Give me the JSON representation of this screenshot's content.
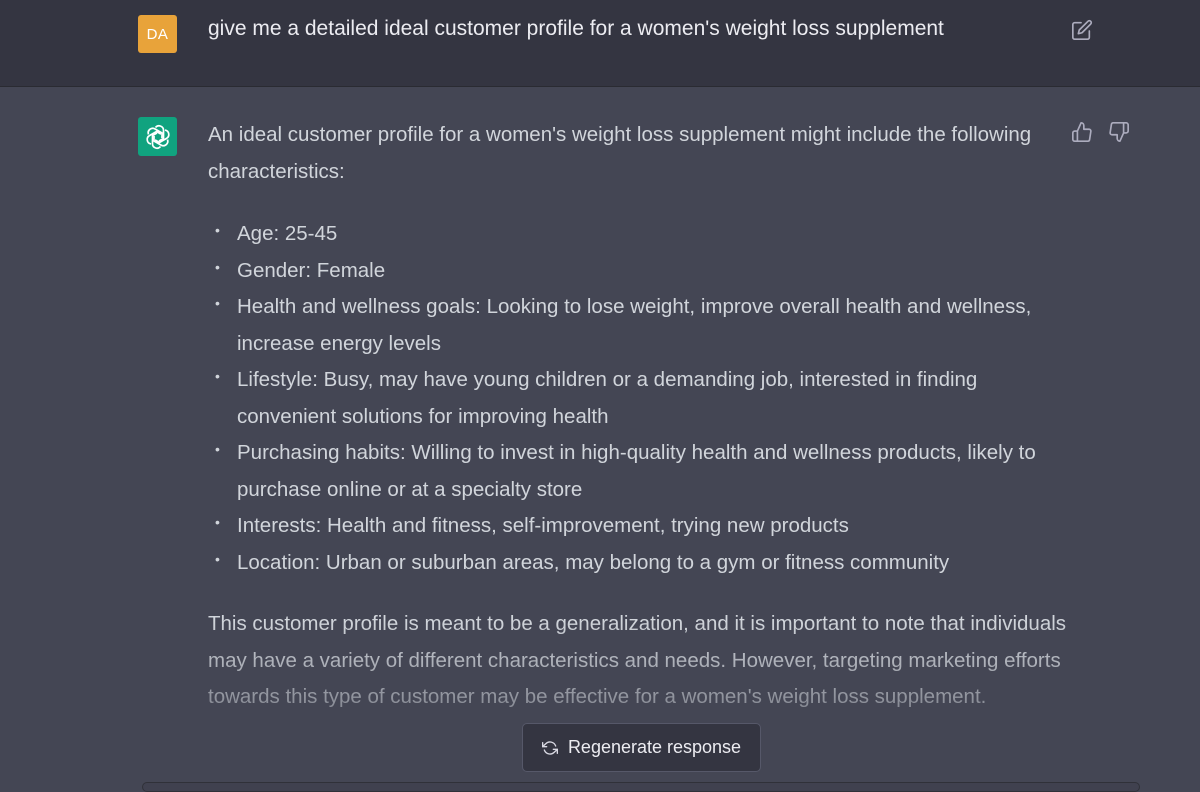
{
  "user_message": {
    "avatar_initials": "DA",
    "text": "give me a detailed ideal customer profile for a women's weight loss supplement",
    "icons": {
      "edit": "edit-icon"
    }
  },
  "assistant_message": {
    "avatar_icon": "openai-logo-icon",
    "intro": "An ideal customer profile for a women's weight loss supplement might include the following characteristics:",
    "bullets": [
      "Age: 25-45",
      "Gender: Female",
      "Health and wellness goals: Looking to lose weight, improve overall health and wellness, increase energy levels",
      "Lifestyle: Busy, may have young children or a demanding job, interested in finding convenient solutions for improving health",
      "Purchasing habits: Willing to invest in high-quality health and wellness products, likely to purchase online or at a specialty store",
      "Interests: Health and fitness, self-improvement, trying new products",
      "Location: Urban or suburban areas, may belong to a gym or fitness community"
    ],
    "conclusion": "This customer profile is meant to be a generalization, and it is important to note that individuals may have a variety of different characteristics and needs. However, targeting marketing efforts towards this type of customer may be effective for a women's weight loss supplement.",
    "icons": {
      "thumbs_up": "thumbs-up-icon",
      "thumbs_down": "thumbs-down-icon"
    }
  },
  "regenerate_button": {
    "label": "Regenerate response",
    "icon": "refresh-icon"
  },
  "colors": {
    "user_bg": "#343541",
    "assistant_bg": "#444654",
    "user_avatar": "#e8a33a",
    "assistant_avatar": "#10a37f"
  }
}
